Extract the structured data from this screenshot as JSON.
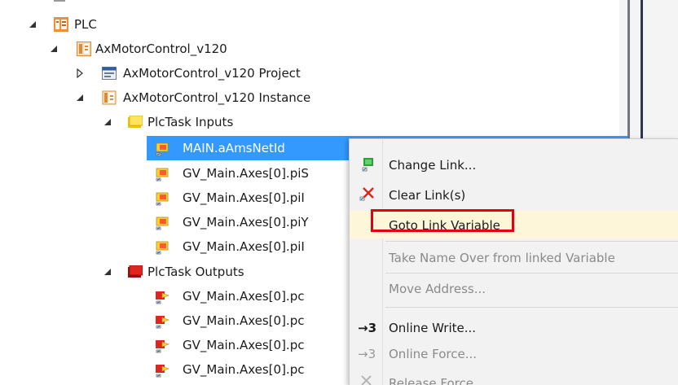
{
  "tree": {
    "plc": "PLC",
    "project": "AxMotorControl_v120",
    "project_node": "AxMotorControl_v120 Project",
    "instance_node": "AxMotorControl_v120 Instance",
    "inputs": "PlcTask Inputs",
    "input_items": [
      "MAIN.aAmsNetId",
      "GV_Main.Axes[0].piS",
      "GV_Main.Axes[0].piI",
      "GV_Main.Axes[0].piY",
      "GV_Main.Axes[0].piI"
    ],
    "outputs": "PlcTask Outputs",
    "output_items": [
      "GV_Main.Axes[0].pc",
      "GV_Main.Axes[0].pc",
      "GV_Main.Axes[0].pc",
      "GV_Main.Axes[0].pc"
    ]
  },
  "context_menu": {
    "change_link": "Change Link...",
    "clear_links": "Clear Link(s)",
    "goto_link_variable": "Goto Link Variable",
    "take_name_over": "Take Name Over from linked Variable",
    "move_address": "Move Address...",
    "online_write_glyph": "→3",
    "online_write": "Online Write...",
    "online_force_glyph": "→3",
    "online_force": "Online Force...",
    "release_force": "Release Force"
  },
  "colors": {
    "selection": "#3399ff",
    "highlight_box": "#e3000f",
    "highlight_fill": "#fdf6d8"
  }
}
